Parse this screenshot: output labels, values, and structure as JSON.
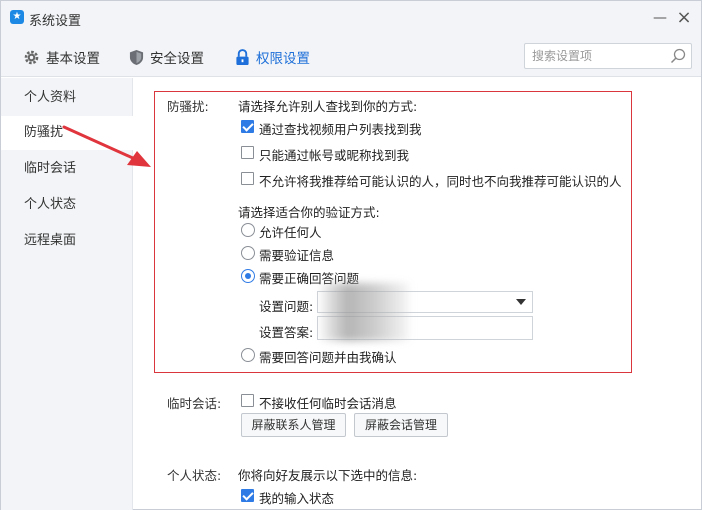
{
  "window": {
    "title": "系统设置",
    "minimize": "—",
    "close": "×"
  },
  "toolbar": {
    "tabs": [
      {
        "label": "基本设置",
        "icon": "gear-icon"
      },
      {
        "label": "安全设置",
        "icon": "shield-icon"
      },
      {
        "label": "权限设置",
        "icon": "lock-icon"
      }
    ],
    "search_placeholder": "搜索设置项"
  },
  "sidebar": {
    "items": [
      {
        "label": "个人资料"
      },
      {
        "label": "防骚扰"
      },
      {
        "label": "临时会话"
      },
      {
        "label": "个人状态"
      },
      {
        "label": "远程桌面"
      }
    ],
    "active": "防骚扰"
  },
  "anti_harass": {
    "label": "防骚扰:",
    "find_prompt": "请选择允许别人查找到你的方式:",
    "find_options": [
      {
        "label": "通过查找视频用户列表找到我",
        "checked": true
      },
      {
        "label": "只能通过帐号或昵称找到我",
        "checked": false
      },
      {
        "label": "不允许将我推荐给可能认识的人，同时也不向我推荐可能认识的人",
        "checked": false
      }
    ],
    "verify_prompt": "请选择适合你的验证方式:",
    "verify_options": [
      {
        "label": "允许任何人",
        "checked": false
      },
      {
        "label": "需要验证信息",
        "checked": false
      },
      {
        "label": "需要正确回答问题",
        "checked": true
      },
      {
        "label": "需要回答问题并由我确认",
        "checked": false
      }
    ],
    "question_label": "设置问题:",
    "answer_label": "设置答案:"
  },
  "temp_session": {
    "label": "临时会话:",
    "option": {
      "label": "不接收任何临时会话消息",
      "checked": false
    },
    "block_contacts_button": "屏蔽联系人管理",
    "block_sessions_button": "屏蔽会话管理"
  },
  "personal_status": {
    "label": "个人状态:",
    "prompt": "你将向好友展示以下选中的信息:",
    "option": {
      "label": "我的输入状态",
      "checked": true
    }
  },
  "colors": {
    "accent": "#2f7be5",
    "annotation": "#d9363e",
    "panel": "#f2f4f7"
  }
}
